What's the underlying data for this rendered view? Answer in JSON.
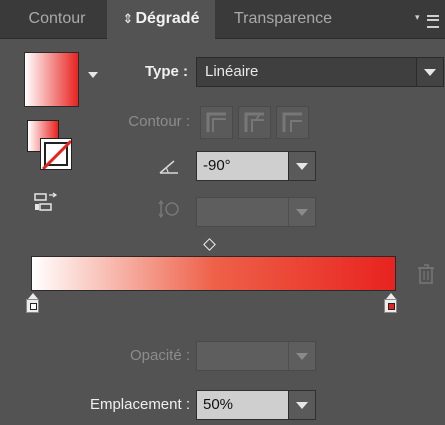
{
  "tabs": [
    {
      "label": "Contour",
      "active": false
    },
    {
      "label": "Dégradé",
      "active": true,
      "icon": "up-down-arrows-icon"
    },
    {
      "label": "Transparence",
      "active": false
    }
  ],
  "type": {
    "label": "Type :",
    "value": "Linéaire"
  },
  "contour": {
    "label": "Contour :"
  },
  "angle": {
    "value": "-90°",
    "icon": "angle-icon"
  },
  "aspect": {
    "value": "",
    "icon": "aspect-ratio-icon"
  },
  "gradient": {
    "start_color": "#ffffff",
    "end_color": "#e8231f",
    "midpoint": "50%"
  },
  "opacity": {
    "label": "Opacité :",
    "value": ""
  },
  "location": {
    "label": "Emplacement :",
    "value": "50%"
  },
  "colors": {
    "panel": "#535353",
    "tabbar": "#3a3a3a",
    "accent_red": "#e8231f"
  }
}
